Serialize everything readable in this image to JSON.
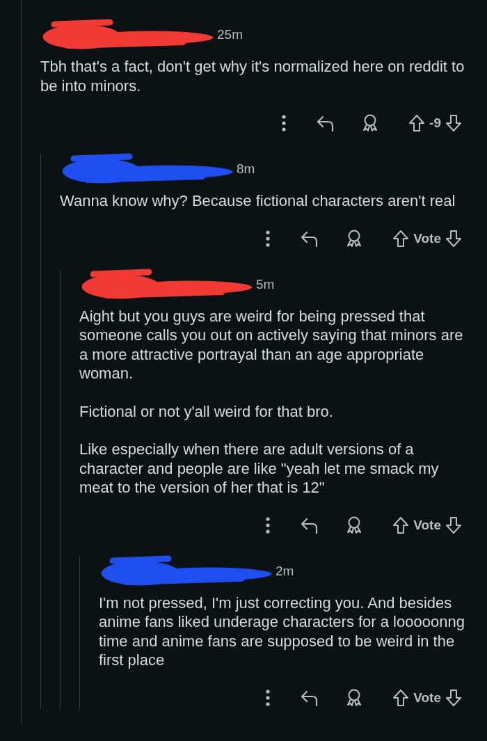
{
  "comments": [
    {
      "redaction": {
        "color": "#f03a33"
      },
      "time": "25m",
      "body": [
        "Tbh that's a fact, don't get why it's normalized here on reddit to be into minors."
      ],
      "score": "-9",
      "children": [
        {
          "redaction": {
            "color": "#1f4ff0"
          },
          "time": "8m",
          "body": [
            "Wanna know why? Because fictional characters aren't real"
          ],
          "score": "Vote",
          "children": [
            {
              "redaction": {
                "color": "#f03a33"
              },
              "time": "5m",
              "body": [
                "Aight but you guys are weird for being pressed that someone calls you out on actively saying that minors are a more attractive portrayal than an age appropriate woman.",
                "Fictional or not y'all weird for that bro.",
                "Like especially when there are adult versions of a character and people are like \"yeah let me smack my meat to the version of her that is 12\""
              ],
              "score": "Vote",
              "children": [
                {
                  "redaction": {
                    "color": "#1f4ff0"
                  },
                  "time": "2m",
                  "body": [
                    "I'm not pressed, I'm just correcting you. And besides anime fans liked underage characters for a looooonng time and anime fans are supposed to be weird in the first place"
                  ],
                  "score": "Vote"
                }
              ]
            }
          ]
        }
      ]
    }
  ]
}
